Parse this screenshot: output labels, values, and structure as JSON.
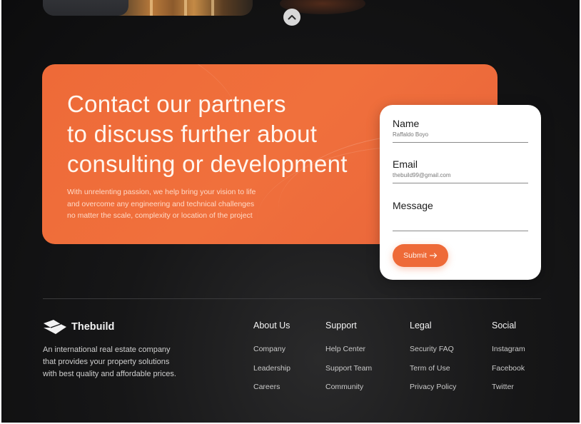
{
  "colors": {
    "accent": "#ee6a38",
    "background": "#131314",
    "card": "#ffffff"
  },
  "cta": {
    "title_lines": [
      "Contact our partners",
      "to discuss further about",
      "consulting or development"
    ],
    "description_lines": [
      "With unrelenting passion, we help bring your vision to life",
      "and overcome any engineering and technical challenges",
      "no matter the scale, complexity or location of the project"
    ]
  },
  "form": {
    "name": {
      "label": "Name",
      "value": "Raffaldo Boyo"
    },
    "email": {
      "label": "Email",
      "value": "thebuild99@gmail.com"
    },
    "message": {
      "label": "Message",
      "value": ""
    },
    "submit": {
      "label": "Submit",
      "icon": "arrow-right-icon"
    }
  },
  "scroll_top": {
    "icon": "chevron-up-icon"
  },
  "footer": {
    "brand": {
      "name": "Thebuild",
      "logo_icon": "thebuild-logo-icon",
      "description_lines": [
        "An international real estate company",
        "that provides your property solutions",
        "with best quality and affordable prices."
      ]
    },
    "columns": [
      {
        "title": "About Us",
        "links": [
          "Company",
          "Leadership",
          "Careers"
        ]
      },
      {
        "title": "Support",
        "links": [
          "Help Center",
          "Support Team",
          "Community"
        ]
      },
      {
        "title": "Legal",
        "links": [
          "Security FAQ",
          "Term of Use",
          "Privacy Policy"
        ]
      },
      {
        "title": "Social",
        "links": [
          "Instagram",
          "Facebook",
          "Twitter"
        ]
      }
    ]
  }
}
